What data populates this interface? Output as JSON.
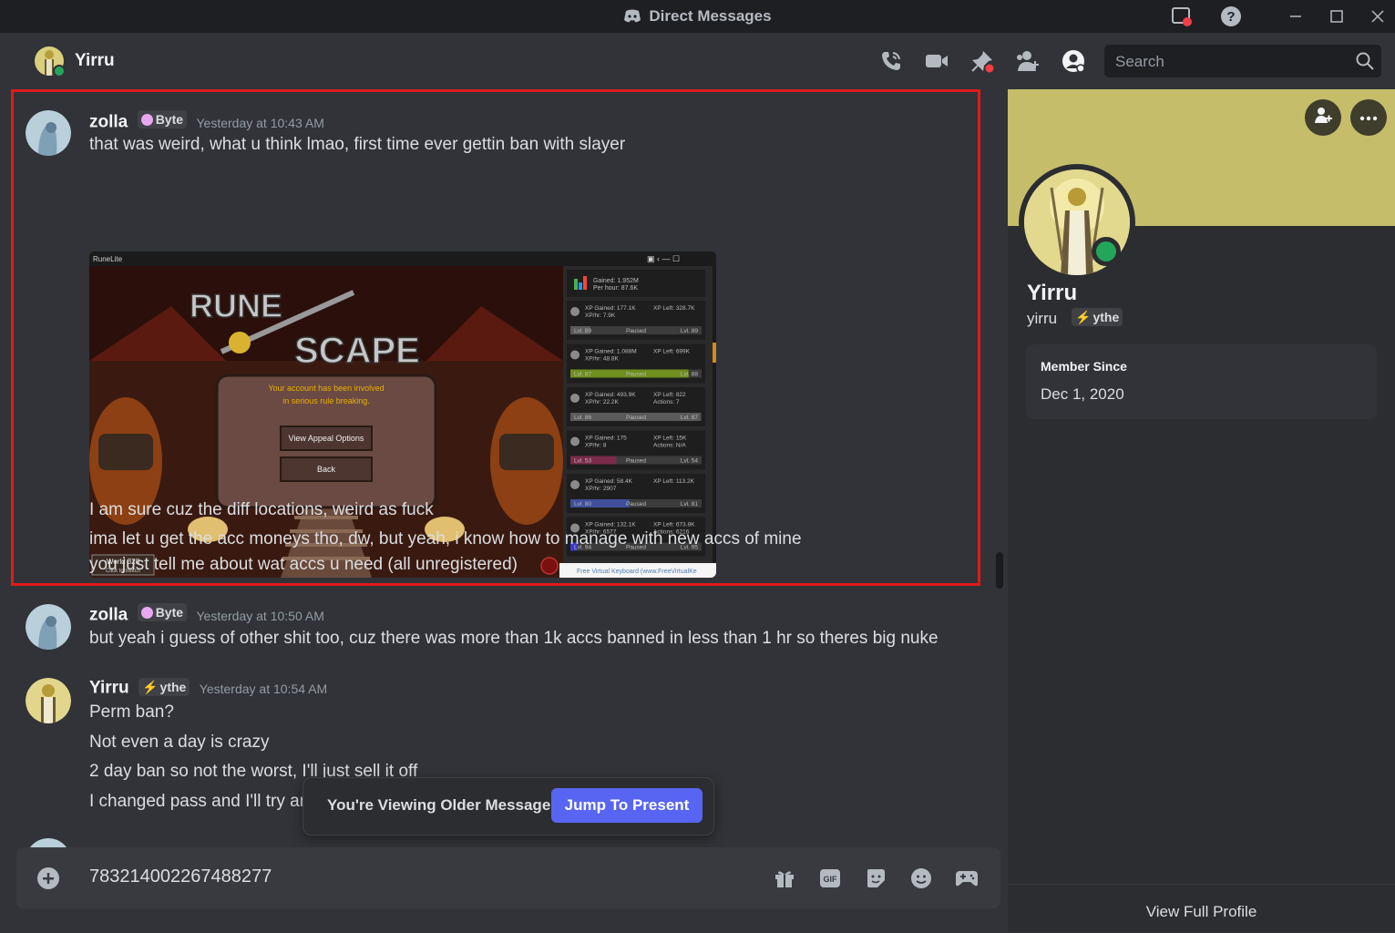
{
  "window": {
    "title": "Direct Messages"
  },
  "header": {
    "name": "Yirru",
    "search_placeholder": "Search"
  },
  "messages": [
    {
      "author": "zolla",
      "tag": "Byte",
      "time": "Yesterday at 10:43 AM",
      "lines": [
        "that was weird, what u think lmao, first time ever gettin ban with slayer",
        "I am sure cuz the diff locations, weird as fuck",
        "ima let u get the acc moneys tho, dw, but yeah, i know how to manage with new accs of mine",
        "you just tell me about wat accs u need (all unregistered)"
      ]
    },
    {
      "author": "zolla",
      "tag": "Byte",
      "time": "Yesterday at 10:50 AM",
      "lines": [
        "but yeah i guess of other shit too, cuz there was more than 1k accs banned in less than 1 hr so theres big nuke"
      ]
    },
    {
      "author": "Yirru",
      "tag": "ythe",
      "time": "Yesterday at 10:54 AM",
      "lines": [
        "Perm ban?",
        "Not even a day is crazy",
        "2 day ban so not the worst, I'll just sell it off",
        "I changed pass and I'll try ar"
      ]
    }
  ],
  "attachment": {
    "client_title": "RuneLite",
    "logo_word_1": "RUNE",
    "logo_word_2": "SCAPE",
    "notice_line_1": "Your account has been involved",
    "notice_line_2": "in serious rule breaking.",
    "appeal_button": "View Appeal Options",
    "back_button": "Back",
    "world": "World 328",
    "world_sub": "Click to switch",
    "keyboard_caption": "Free Virtual Keyboard (www.FreeVirtualKe",
    "summary_line_1": "Gained: 1.952M",
    "summary_line_2": "Per hour: 87.6K",
    "skills": [
      {
        "gained": "XP Gained: 177.1K",
        "rate": "XP/hr: 7.9K",
        "left": "XP Left: 328.7K",
        "extra": "",
        "lvl_from": "Lvl. 89",
        "lvl_to": "Lvl. 89",
        "status": "Paused",
        "progress": 0.15,
        "color": "#5a5a5a"
      },
      {
        "gained": "XP Gained: 1.088M",
        "rate": "XP/hr: 48.8K",
        "left": "XP Left: 699K",
        "extra": "",
        "lvl_from": "Lvl. 87",
        "lvl_to": "Lvl. 88",
        "status": "Paused",
        "progress": 0.9,
        "color": "#6f8f1e"
      },
      {
        "gained": "XP Gained: 493.9K",
        "rate": "XP/hr: 22.2K",
        "left": "XP Left: 822",
        "extra": "Actions: 7",
        "lvl_from": "Lvl. 86",
        "lvl_to": "Lvl. 87",
        "status": "Paused",
        "progress": 0.99,
        "color": "#5a5a5a"
      },
      {
        "gained": "XP Gained: 175",
        "rate": "XP/hr: 8",
        "left": "XP Left: 15K",
        "extra": "Actions: N/A",
        "lvl_from": "Lvl. 53",
        "lvl_to": "Lvl. 54",
        "status": "Paused",
        "progress": 0.35,
        "color": "#7a2c4a"
      },
      {
        "gained": "XP Gained: 58.4K",
        "rate": "XP/hr: 2907",
        "left": "XP Left: 113.2K",
        "extra": "",
        "lvl_from": "Lvl. 80",
        "lvl_to": "Lvl. 81",
        "status": "Paused",
        "progress": 0.45,
        "color": "#3f4f9a"
      },
      {
        "gained": "XP Gained: 132.1K",
        "rate": "XP/hr: 6577",
        "left": "XP Left: 673.8K",
        "extra": "Actions: 6216",
        "lvl_from": "Lvl. 94",
        "lvl_to": "Lvl. 95",
        "status": "Paused",
        "progress": 0.05,
        "color": "#3a3acf"
      }
    ]
  },
  "composer": {
    "text": "783214002267488277"
  },
  "older_banner": {
    "text": "You're Viewing Older Messages",
    "button": "Jump To Present"
  },
  "profile": {
    "display_name": "Yirru",
    "username": "yirru",
    "tag": "ythe",
    "member_since_label": "Member Since",
    "member_since": "Dec 1, 2020",
    "view_full": "View Full Profile",
    "banner_color": "#c5bd6a"
  },
  "icons": {
    "titlebar": [
      "discord-logo-icon",
      "inbox-icon",
      "help-icon",
      "minimize-icon",
      "maximize-icon",
      "close-icon"
    ],
    "header": [
      "voice-call-icon",
      "video-call-icon",
      "pin-icon",
      "add-friends-icon",
      "user-profile-icon",
      "search-icon"
    ],
    "composer": [
      "attach-plus-icon",
      "gift-icon",
      "gif-icon",
      "sticker-icon",
      "emoji-icon",
      "activities-icon"
    ]
  },
  "colors": {
    "accent": "#5865f2",
    "online": "#23a55a",
    "highlight": "#e01b1b"
  }
}
